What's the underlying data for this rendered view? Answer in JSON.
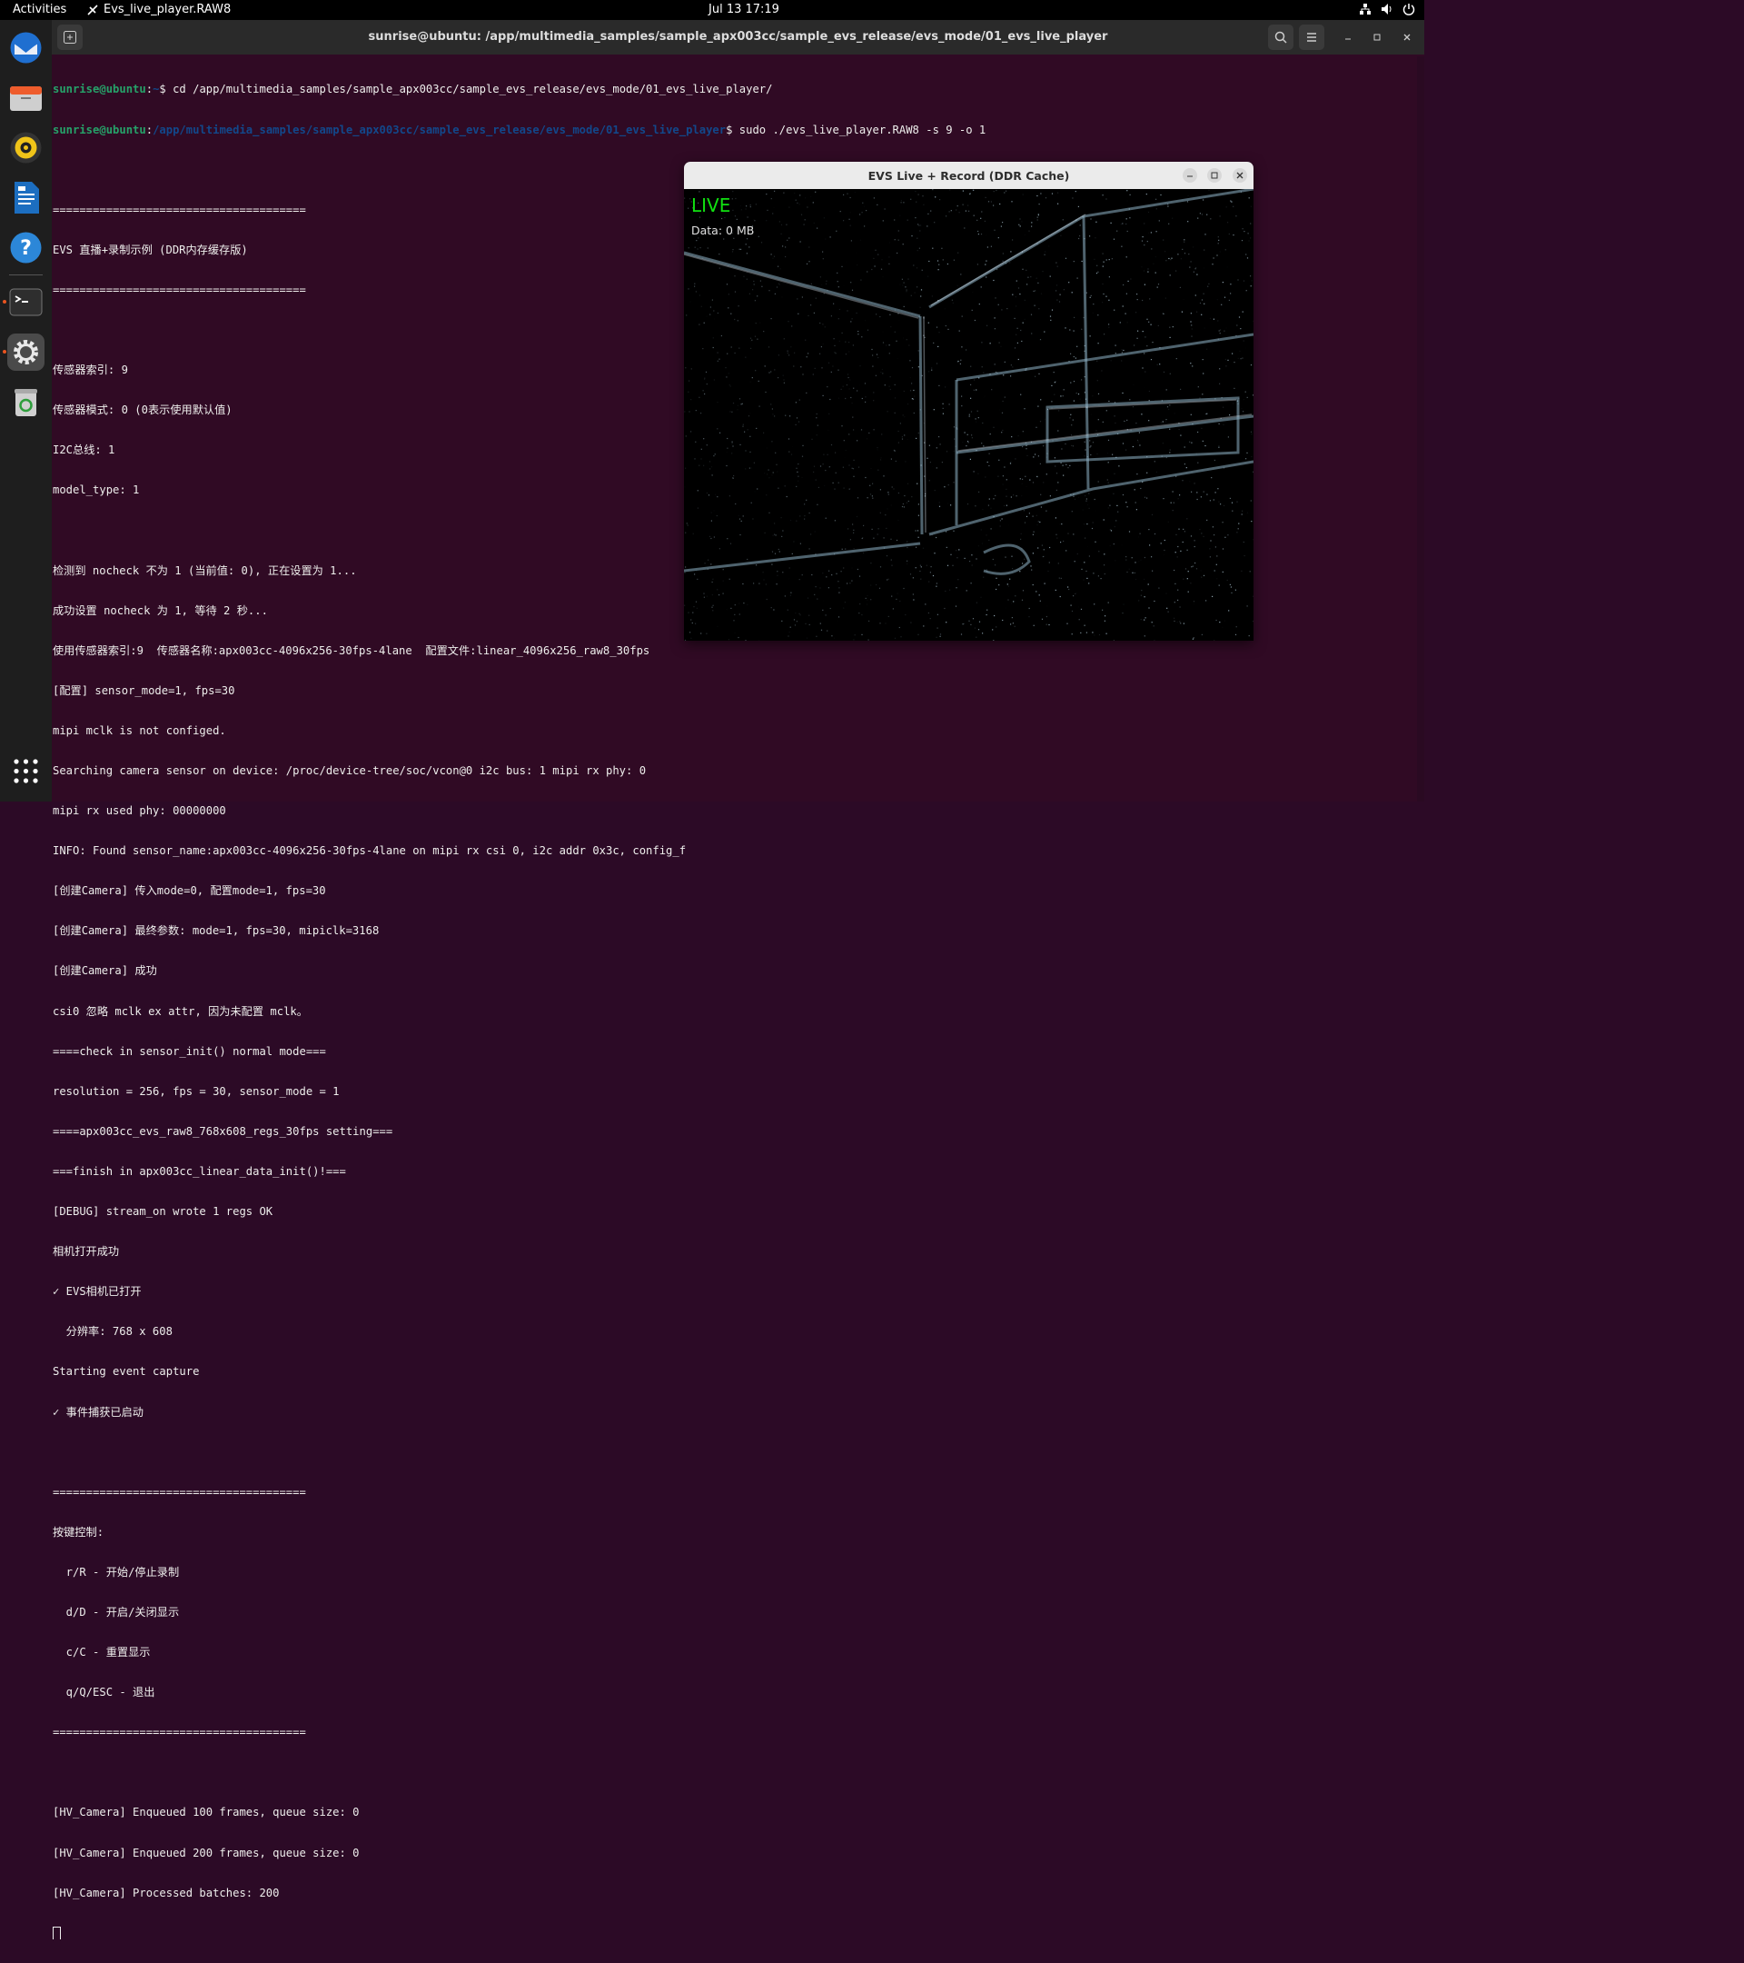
{
  "topbar": {
    "activities": "Activities",
    "app_name": "Evs_live_player.RAW8",
    "clock": "Jul 13  17:19"
  },
  "terminal": {
    "title": "sunrise@ubuntu: /app/multimedia_samples/sample_apx003cc/sample_evs_release/evs_mode/01_evs_live_player",
    "prompt1": {
      "user": "sunrise@ubuntu",
      "path": "~",
      "cmd": "$ cd /app/multimedia_samples/sample_apx003cc/sample_evs_release/evs_mode/01_evs_live_player/"
    },
    "prompt2": {
      "user": "sunrise@ubuntu",
      "path": "/app/multimedia_samples/sample_apx003cc/sample_evs_release/evs_mode/01_evs_live_player",
      "cmd": "$ sudo ./evs_live_player.RAW8 -s 9 -o 1"
    },
    "lines": [
      "",
      "======================================",
      "EVS 直播+录制示例 (DDR内存缓存版)",
      "======================================",
      "",
      "传感器索引: 9",
      "传感器模式: 0 (0表示使用默认值)",
      "I2C总线: 1",
      "model_type: 1",
      "",
      "检测到 nocheck 不为 1 (当前值: 0), 正在设置为 1...",
      "成功设置 nocheck 为 1, 等待 2 秒...",
      "使用传感器索引:9  传感器名称:apx003cc-4096x256-30fps-4lane  配置文件:linear_4096x256_raw8_30fps",
      "[配置] sensor_mode=1, fps=30",
      "mipi mclk is not configed.",
      "Searching camera sensor on device: /proc/device-tree/soc/vcon@0 i2c bus: 1 mipi rx phy: 0",
      "mipi rx used phy: 00000000",
      "INFO: Found sensor_name:apx003cc-4096x256-30fps-4lane on mipi rx csi 0, i2c addr 0x3c, config_f",
      "[创建Camera] 传入mode=0, 配置mode=1, fps=30",
      "[创建Camera] 最终参数: mode=1, fps=30, mipiclk=3168",
      "[创建Camera] 成功",
      "csi0 忽略 mclk ex attr, 因为未配置 mclk。",
      "====check in sensor_init() normal mode===",
      "resolution = 256, fps = 30, sensor_mode = 1",
      "====apx003cc_evs_raw8_768x608_regs_30fps setting===",
      "===finish in apx003cc_linear_data_init()!===",
      "[DEBUG] stream_on wrote 1 regs OK",
      "相机打开成功",
      "✓ EVS相机已打开",
      "  分辨率: 768 x 608",
      "Starting event capture",
      "✓ 事件捕获已启动",
      "",
      "======================================",
      "按键控制:",
      "  r/R - 开始/停止录制",
      "  d/D - 开启/关闭显示",
      "  c/C - 重置显示",
      "  q/Q/ESC - 退出",
      "======================================",
      "",
      "[HV_Camera] Enqueued 100 frames, queue size: 0",
      "[HV_Camera] Enqueued 200 frames, queue size: 0",
      "[HV_Camera] Processed batches: 200"
    ]
  },
  "live_window": {
    "title": "EVS Live + Record (DDR Cache)",
    "live_label": "LIVE",
    "data_label": "Data: 0 MB"
  }
}
